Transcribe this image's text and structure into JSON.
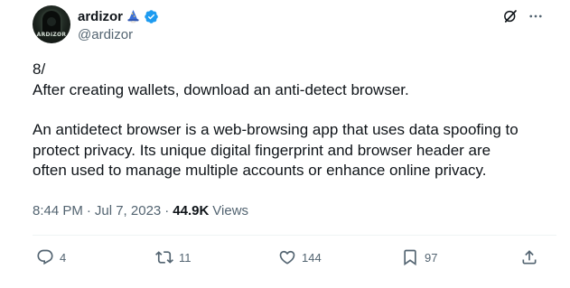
{
  "author": {
    "display_name": "ardizor",
    "handle": "@ardizor",
    "avatar_text": "ARDIZOR",
    "badge_emoji": "wizard-icon",
    "verified_icon": "verified-badge-icon",
    "verified_color": "#1d9bf0"
  },
  "header_icons": [
    "grok-icon",
    "more-options-icon"
  ],
  "tweet": {
    "line1": "8/",
    "line2": "After creating wallets, download an anti-detect browser.",
    "line3": "An antidetect browser is a web-browsing app that uses data spoofing to",
    "line4": "protect privacy. Its unique digital fingerprint and browser header are",
    "line5": "often used to manage multiple accounts or enhance online privacy."
  },
  "meta": {
    "time": "8:44 PM",
    "separator": "·",
    "date": "Jul 7, 2023",
    "views_count": "44.9K",
    "views_label": "Views"
  },
  "actions": {
    "replies": "4",
    "reposts": "11",
    "likes": "144",
    "bookmarks": "97"
  },
  "colors": {
    "text_primary": "#0f1419",
    "text_secondary": "#536471",
    "divider": "#eff3f4"
  }
}
